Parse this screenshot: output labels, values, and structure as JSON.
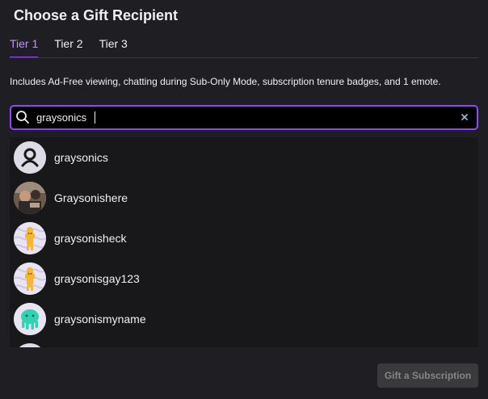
{
  "dialog": {
    "title": "Choose a Gift Recipient"
  },
  "tabs": [
    {
      "label": "Tier 1",
      "active": true
    },
    {
      "label": "Tier 2",
      "active": false
    },
    {
      "label": "Tier 3",
      "active": false
    }
  ],
  "description": "Includes Ad-Free viewing, chatting during Sub-Only Mode, subscription tenure badges, and 1 emote.",
  "search": {
    "value": "graysonics",
    "icon": "search-icon",
    "clear_icon": "close-icon"
  },
  "results": [
    {
      "name": "graysonics",
      "avatar": "default-user-icon"
    },
    {
      "name": "Graysonishere",
      "avatar": "photo-avatar"
    },
    {
      "name": "graysonisheck",
      "avatar": "yellow-mascot-avatar"
    },
    {
      "name": "graysonisgay123",
      "avatar": "yellow-mascot-avatar"
    },
    {
      "name": "graysonismyname",
      "avatar": "green-mascot-avatar"
    }
  ],
  "footer": {
    "gift_button_label": "Gift a Subscription"
  },
  "colors": {
    "accent": "#9147ff",
    "background": "#1f1f23",
    "list_background": "#18181b"
  }
}
